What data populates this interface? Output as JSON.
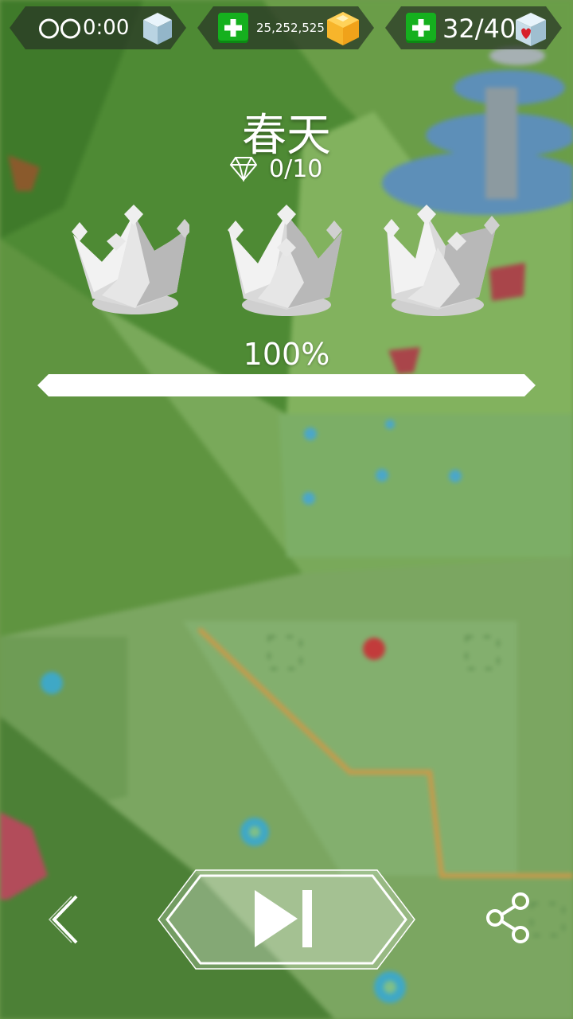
{
  "hud": {
    "timer": {
      "infinity_symbol": "∞",
      "value": "0:00",
      "icon": "ice-cube-icon"
    },
    "currency": {
      "value": "25,252,525",
      "icon": "gold-gem-cube-icon",
      "add_icon": "plus-icon"
    },
    "lives": {
      "value": "32/40",
      "icon": "heart-cube-icon",
      "add_icon": "plus-icon"
    }
  },
  "level": {
    "title": "春天",
    "gems": "0/10",
    "gem_icon": "diamond-icon",
    "crowns": [
      "crown-icon",
      "crown-icon",
      "crown-icon"
    ],
    "progress_label": "100%",
    "progress_fraction": 1.0
  },
  "controls": {
    "back_icon": "chevron-left-icon",
    "next_icon": "skip-next-icon",
    "share_icon": "share-icon"
  },
  "colors": {
    "hud_bg": "#283426",
    "plus_green": "#15b01e",
    "gold": "#f5a623",
    "progress": "#ffffff"
  }
}
